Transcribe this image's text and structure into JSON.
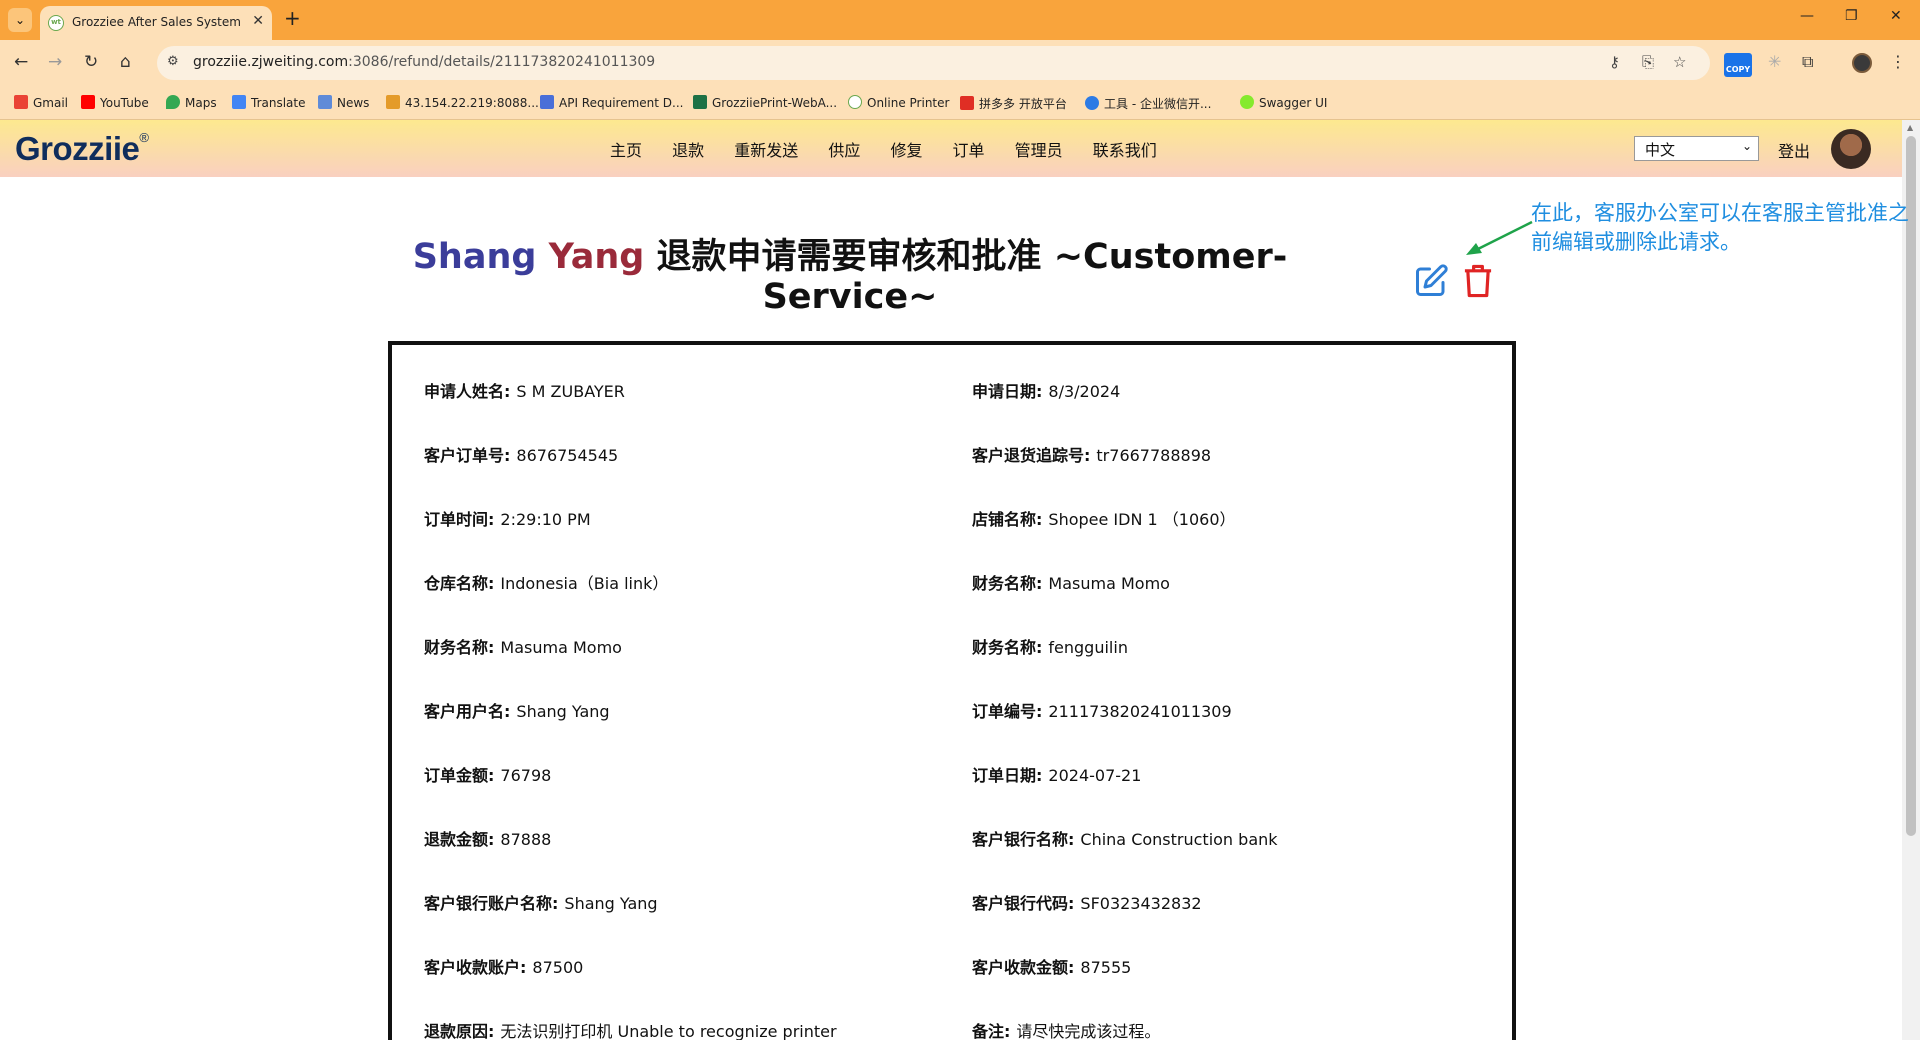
{
  "browser": {
    "tab_title": "Grozziee After Sales System",
    "url_host": "grozziie.zjweiting.com",
    "url_path": ":3086/refund/details/211173820241011309",
    "bookmarks": [
      {
        "label": "Gmail"
      },
      {
        "label": "YouTube"
      },
      {
        "label": "Maps"
      },
      {
        "label": "Translate"
      },
      {
        "label": "News"
      },
      {
        "label": "43.154.22.219:8088..."
      },
      {
        "label": "API Requirement D..."
      },
      {
        "label": "GrozziiePrint-WebA..."
      },
      {
        "label": "Online Printer"
      },
      {
        "label": "拼多多 开放平台"
      },
      {
        "label": "工具 - 企业微信开..."
      },
      {
        "label": "Swagger UI"
      }
    ],
    "copy_ext_label": "COPY"
  },
  "header": {
    "logo": "Grozziie",
    "logo_mark": "®",
    "nav": [
      "主页",
      "退款",
      "重新发送",
      "供应",
      "修复",
      "订单",
      "管理员",
      "联系我们"
    ],
    "language": "中文",
    "logout": "登出"
  },
  "title": {
    "name_first": "Shang",
    "name_last": "Yang",
    "text": "退款申请需要审核和批准 ~Customer-Service~"
  },
  "annotation": {
    "text": "在此，客服办公室可以在客服主管批准之前编辑或删除此请求。",
    "color": "#1f8ee0",
    "arrow_color": "#1fa34a"
  },
  "details": [
    {
      "label": "申请人姓名:",
      "value": "S M ZUBAYER"
    },
    {
      "label": "申请日期:",
      "value": "8/3/2024"
    },
    {
      "label": "客户订单号:",
      "value": "8676754545"
    },
    {
      "label": "客户退货追踪号:",
      "value": "tr7667788898"
    },
    {
      "label": "订单时间:",
      "value": "2:29:10 PM"
    },
    {
      "label": "店铺名称:",
      "value": "Shopee IDN 1 （1060）"
    },
    {
      "label": "仓库名称:",
      "value": "Indonesia（Bia link）"
    },
    {
      "label": "财务名称:",
      "value": "Masuma Momo"
    },
    {
      "label": "财务名称:",
      "value": "Masuma Momo"
    },
    {
      "label": "财务名称:",
      "value": "fengguilin"
    },
    {
      "label": "客户用户名:",
      "value": "Shang Yang"
    },
    {
      "label": "订单编号:",
      "value": "211173820241011309"
    },
    {
      "label": "订单金额:",
      "value": "76798"
    },
    {
      "label": "订单日期:",
      "value": "2024-07-21"
    },
    {
      "label": "退款金额:",
      "value": "87888"
    },
    {
      "label": "客户银行名称:",
      "value": "China Construction bank"
    },
    {
      "label": "客户银行账户名称:",
      "value": "Shang Yang"
    },
    {
      "label": "客户银行代码:",
      "value": "SF0323432832"
    },
    {
      "label": "客户收款账户:",
      "value": "87500"
    },
    {
      "label": "客户收款金额:",
      "value": "87555"
    },
    {
      "label": "退款原因:",
      "value": "无法识别打印机 Unable to recognize printer"
    },
    {
      "label": "备注:",
      "value": "请尽快完成该过程。"
    }
  ],
  "colors": {
    "tabbar": "#f9a43c",
    "toolbar": "#fde0b8",
    "edit_icon": "#2f7fd6",
    "delete_icon": "#e02424"
  }
}
